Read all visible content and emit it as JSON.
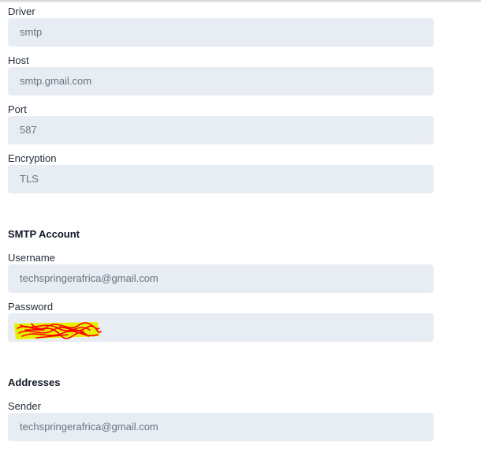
{
  "mail_settings": {
    "driver": {
      "label": "Driver",
      "value": "smtp"
    },
    "host": {
      "label": "Host",
      "value": "smtp.gmail.com"
    },
    "port": {
      "label": "Port",
      "value": "587"
    },
    "encryption": {
      "label": "Encryption",
      "value": "TLS"
    }
  },
  "smtp_account": {
    "title": "SMTP Account",
    "username": {
      "label": "Username",
      "value": "techspringerafrica@gmail.com"
    },
    "password": {
      "label": "Password",
      "value": ""
    }
  },
  "addresses": {
    "title": "Addresses",
    "sender": {
      "label": "Sender",
      "value": "techspringerafrica@gmail.com"
    }
  },
  "colors": {
    "field_background": "#e8ecf3",
    "field_text": "#6b7280",
    "redaction_highlight": "#e6f000",
    "redaction_scribble": "#ff0000"
  }
}
